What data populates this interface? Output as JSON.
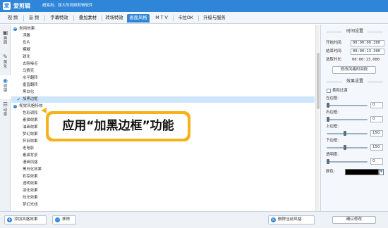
{
  "app": {
    "logo_glyph": "爱",
    "name": "爱剪辑",
    "slogan": "超易用、强大的视频剪辑软件"
  },
  "menu": {
    "items": [
      {
        "label": "视 频"
      },
      {
        "label": "音 频"
      },
      {
        "label": "字幕特效"
      },
      {
        "label": "叠加素材"
      },
      {
        "label": "转场特效"
      },
      {
        "label": "画面风格"
      },
      {
        "label": "M T V"
      },
      {
        "label": "卡拉OK"
      },
      {
        "label": "升级与服务"
      }
    ],
    "active": "画面风格"
  },
  "leftnav": {
    "tabs": [
      {
        "label": "画面",
        "icon": "image-icon"
      },
      {
        "label": "美化",
        "icon": "brush-icon"
      },
      {
        "label": "滤镜",
        "icon": "filter-icon"
      },
      {
        "label": "动景",
        "icon": "motion-icon"
      }
    ],
    "active": "滤镜"
  },
  "list": {
    "cat1": "常用效果",
    "cat1_items": [
      "浮雕",
      "负片",
      "模糊",
      "锐化",
      "去除噪点",
      "马赛克",
      "水平翻转",
      "垂直翻转",
      "黑白化"
    ],
    "selected": "加黑边框",
    "cat2": "视觉风格特效",
    "cat2_items": [
      "色彩调和",
      "素描效果",
      "油画效果",
      "梦幻效果",
      "怀旧效果",
      "老电影",
      "素描背景",
      "漫画风格",
      "黑白化效果",
      "彩铅效果",
      "透明效果",
      "羽化效果",
      "炫光效果",
      "梦幻光线",
      "老电影"
    ]
  },
  "callout": {
    "text": "应用“加黑边框”功能"
  },
  "bottom": {
    "add_label": "添加风格效果",
    "clear_label": "移除",
    "delete_label": "删除当前风格"
  },
  "right": {
    "time_section": "时间设置",
    "start_label": "开始时间:",
    "start_value": "00:00:00.300",
    "end_label": "结束时间:",
    "end_value": "00:00:13.300",
    "dur_label": "选取时长:",
    "dur_value": "00:00:13.000",
    "modify_time_btn": "修改风格时间段",
    "effect_section": "效果设置",
    "soft_transition_label": "柔和过渡",
    "sliders": [
      {
        "label": "左边框:",
        "value": "0",
        "level": 0
      },
      {
        "label": "右边框:",
        "value": "0",
        "level": 0
      },
      {
        "label": "上边框:",
        "value": "150",
        "level": 0.45
      },
      {
        "label": "下边框:",
        "value": "150",
        "level": 0.45
      },
      {
        "label": "透明度:",
        "value": "0",
        "level": 0
      }
    ],
    "color_label": "颜色:",
    "color_value": "#000000",
    "confirm_btn": "确认修改"
  }
}
